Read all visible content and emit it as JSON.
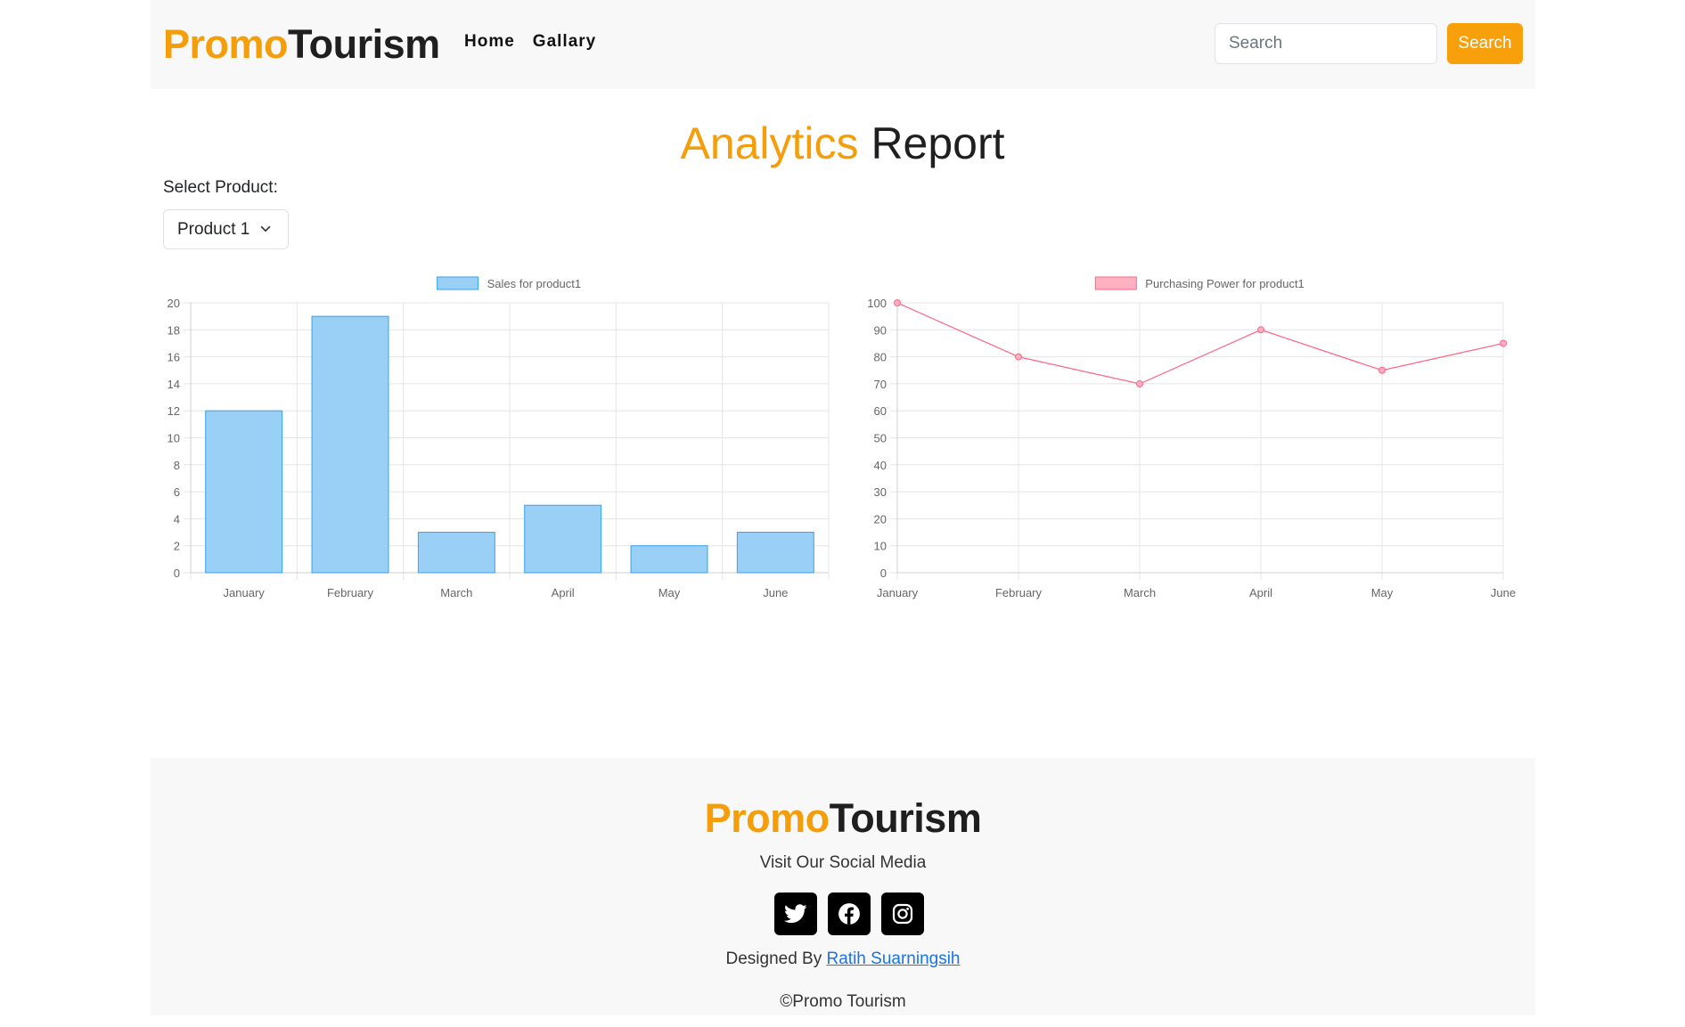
{
  "header": {
    "brand_accent": "Promo",
    "brand_rest": "Tourism",
    "nav": [
      {
        "label": "Home"
      },
      {
        "label": "Gallary"
      }
    ],
    "search_placeholder": "Search",
    "search_button": "Search"
  },
  "title": {
    "accent": "Analytics",
    "rest": "Report"
  },
  "filter": {
    "label": "Select Product:",
    "selected": "Product 1"
  },
  "colors": {
    "accent": "#f59e0b",
    "bar_fill": "#9ad0f5",
    "bar_stroke": "#36a2eb",
    "line_stroke": "#ff6384",
    "line_fill": "#ffb1c1"
  },
  "chart_data": [
    {
      "type": "bar",
      "categories": [
        "January",
        "February",
        "March",
        "April",
        "May",
        "June"
      ],
      "series": [
        {
          "name": "Sales for product1",
          "values": [
            12,
            19,
            3,
            5,
            2,
            3
          ]
        }
      ],
      "ylim": [
        0,
        20
      ],
      "yticks": [
        0,
        2,
        4,
        6,
        8,
        10,
        12,
        14,
        16,
        18,
        20
      ],
      "legend": "top-center",
      "grid": true
    },
    {
      "type": "line",
      "categories": [
        "January",
        "February",
        "March",
        "April",
        "May",
        "June"
      ],
      "series": [
        {
          "name": "Purchasing Power for product1",
          "values": [
            100,
            80,
            70,
            90,
            75,
            85
          ]
        }
      ],
      "ylim": [
        0,
        100
      ],
      "yticks": [
        0,
        10,
        20,
        30,
        40,
        50,
        60,
        70,
        80,
        90,
        100
      ],
      "legend": "top-center",
      "grid": true
    }
  ],
  "footer": {
    "brand_accent": "Promo",
    "brand_rest": "Tourism",
    "social_text": "Visit Our Social Media",
    "social": [
      {
        "icon": "twitter-icon"
      },
      {
        "icon": "facebook-icon"
      },
      {
        "icon": "instagram-icon"
      }
    ],
    "designed_by": "Designed By",
    "designer": "Ratih Suarningsih",
    "copyright": "©Promo Tourism"
  }
}
